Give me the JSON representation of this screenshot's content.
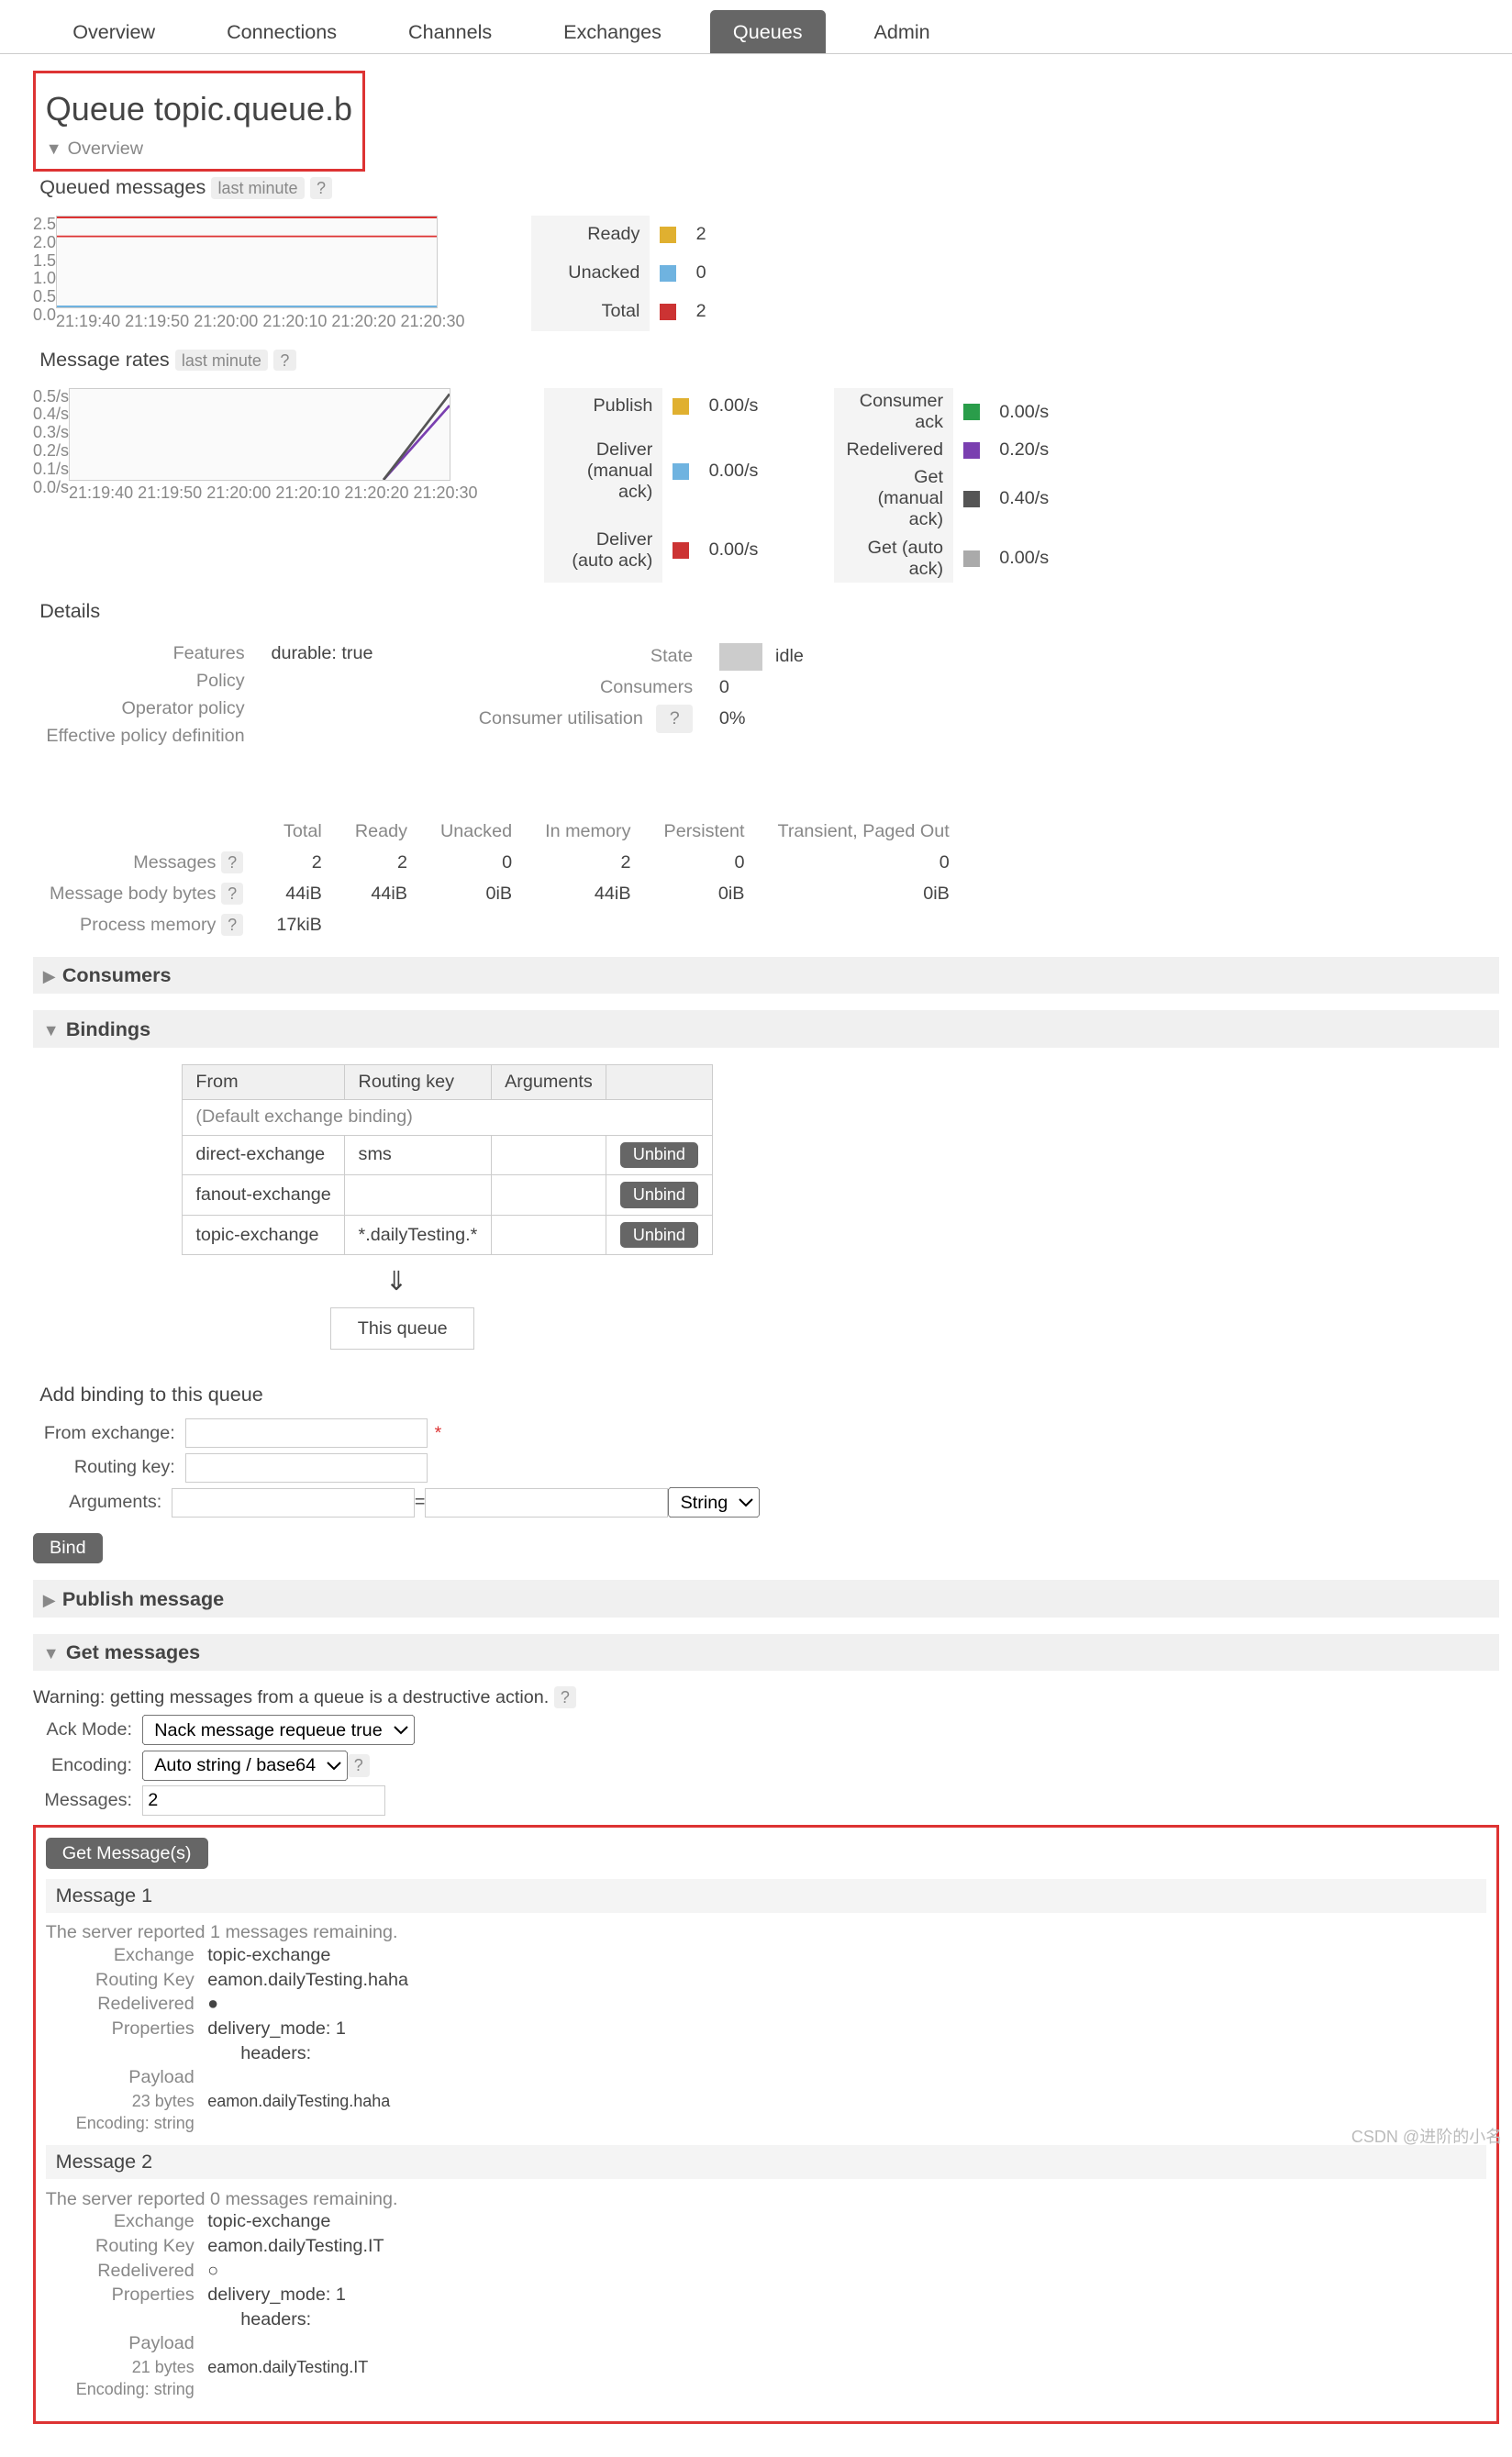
{
  "tabs": {
    "overview": "Overview",
    "connections": "Connections",
    "channels": "Channels",
    "exchanges": "Exchanges",
    "queues": "Queues",
    "admin": "Admin",
    "active": "queues"
  },
  "page_title_prefix": "Queue ",
  "page_title_name": "topic.queue.b",
  "overview_label": "Overview",
  "queued_messages": {
    "label": "Queued messages",
    "range": "last minute",
    "help": "?",
    "colors": {
      "ready": "#e0b030",
      "unacked": "#6fb3e0",
      "total": "#c33"
    }
  },
  "chart_data": [
    {
      "type": "line",
      "title": "Queued messages",
      "ylim": [
        0,
        2.5
      ],
      "yticks": [
        "2.5",
        "2.0",
        "1.5",
        "1.0",
        "0.5",
        "0.0"
      ],
      "xticks": [
        "21:19:40",
        "21:19:50",
        "21:20:00",
        "21:20:10",
        "21:20:20",
        "21:20:30"
      ],
      "series": [
        {
          "name": "Ready",
          "color": "#e0b030",
          "value": "2"
        },
        {
          "name": "Unacked",
          "color": "#6fb3e0",
          "value": "0"
        },
        {
          "name": "Total",
          "color": "#c33",
          "value": "2"
        }
      ]
    },
    {
      "type": "line",
      "title": "Message rates",
      "ylim": [
        0,
        0.5
      ],
      "yticks": [
        "0.5/s",
        "0.4/s",
        "0.3/s",
        "0.2/s",
        "0.1/s",
        "0.0/s"
      ],
      "xticks": [
        "21:19:40",
        "21:19:50",
        "21:20:00",
        "21:20:10",
        "21:20:20",
        "21:20:30"
      ],
      "series": [
        {
          "name": "Publish",
          "color": "#e0b030",
          "value": "0.00/s"
        },
        {
          "name": "Deliver (manual ack)",
          "color": "#6fb3e0",
          "value": "0.00/s"
        },
        {
          "name": "Deliver (auto ack)",
          "color": "#c33",
          "value": "0.00/s"
        },
        {
          "name": "Consumer ack",
          "color": "#2a9d4a",
          "value": "0.00/s"
        },
        {
          "name": "Redelivered",
          "color": "#7a3fb0",
          "value": "0.20/s"
        },
        {
          "name": "Get (manual ack)",
          "color": "#555",
          "value": "0.40/s"
        },
        {
          "name": "Get (auto ack)",
          "color": "#aaa",
          "value": "0.00/s"
        }
      ]
    }
  ],
  "message_rates": {
    "label": "Message rates",
    "range": "last minute",
    "help": "?"
  },
  "details": {
    "heading": "Details",
    "left": [
      [
        "Features",
        "durable: true"
      ],
      [
        "Policy",
        ""
      ],
      [
        "Operator policy",
        ""
      ],
      [
        "Effective policy definition",
        ""
      ]
    ],
    "mid": [
      [
        "State",
        "idle"
      ],
      [
        "Consumers",
        "0"
      ],
      [
        "Consumer utilisation",
        "0%"
      ]
    ],
    "state_color": "#ccc",
    "cu_help": "?",
    "facts_cols": [
      "Total",
      "Ready",
      "Unacked",
      "In memory",
      "Persistent",
      "Transient, Paged Out"
    ],
    "facts_rows": [
      {
        "label": "Messages",
        "help": "?",
        "cells": [
          "2",
          "2",
          "0",
          "2",
          "0",
          "0"
        ]
      },
      {
        "label": "Message body bytes",
        "help": "?",
        "cells": [
          "44iB",
          "44iB",
          "0iB",
          "44iB",
          "0iB",
          "0iB"
        ]
      },
      {
        "label": "Process memory",
        "help": "?",
        "cells": [
          "17kiB",
          "",
          "",
          "",
          "",
          ""
        ]
      }
    ]
  },
  "consumers_label": "Consumers",
  "bindings": {
    "label": "Bindings",
    "cols": [
      "From",
      "Routing key",
      "Arguments",
      ""
    ],
    "default_row": "(Default exchange binding)",
    "rows": [
      {
        "from": "direct-exchange",
        "rk": "sms",
        "args": "",
        "unbind": "Unbind"
      },
      {
        "from": "fanout-exchange",
        "rk": "",
        "args": "",
        "unbind": "Unbind"
      },
      {
        "from": "topic-exchange",
        "rk": "*.dailyTesting.*",
        "args": "",
        "unbind": "Unbind"
      }
    ],
    "arrow": "⇓",
    "this_queue": "This queue"
  },
  "add_binding": {
    "heading": "Add binding to this queue",
    "from_label": "From exchange:",
    "rk_label": "Routing key:",
    "args_label": "Arguments:",
    "eq": "=",
    "type_sel": "String",
    "btn": "Bind",
    "required": "*"
  },
  "publish_label": "Publish message",
  "get_messages": {
    "label": "Get messages",
    "warning": "Warning: getting messages from a queue is a destructive action.",
    "help": "?",
    "ack_label": "Ack Mode:",
    "ack_value": "Nack message requeue true",
    "enc_label": "Encoding:",
    "enc_value": "Auto string / base64",
    "enc_help": "?",
    "msgs_label": "Messages:",
    "msgs_value": "2",
    "btn": "Get Message(s)"
  },
  "messages": [
    {
      "title": "Message 1",
      "remaining": "The server reported 1 messages remaining.",
      "exchange": "topic-exchange",
      "routing_key": "eamon.dailyTesting.haha",
      "redelivered": "●",
      "props": "delivery_mode: 1",
      "props2": "headers:",
      "payload": "eamon.dailyTesting.haha",
      "payload_meta": "23 bytes",
      "payload_enc": "Encoding: string"
    },
    {
      "title": "Message 2",
      "remaining": "The server reported 0 messages remaining.",
      "exchange": "topic-exchange",
      "routing_key": "eamon.dailyTesting.IT",
      "redelivered": "○",
      "props": "delivery_mode: 1",
      "props2": "headers:",
      "payload": "eamon.dailyTesting.IT",
      "payload_meta": "21 bytes",
      "payload_enc": "Encoding: string"
    }
  ],
  "labels": {
    "exchange": "Exchange",
    "rk": "Routing Key",
    "redeliv": "Redelivered",
    "props": "Properties",
    "payload": "Payload"
  },
  "watermark": "CSDN @进阶的小名"
}
